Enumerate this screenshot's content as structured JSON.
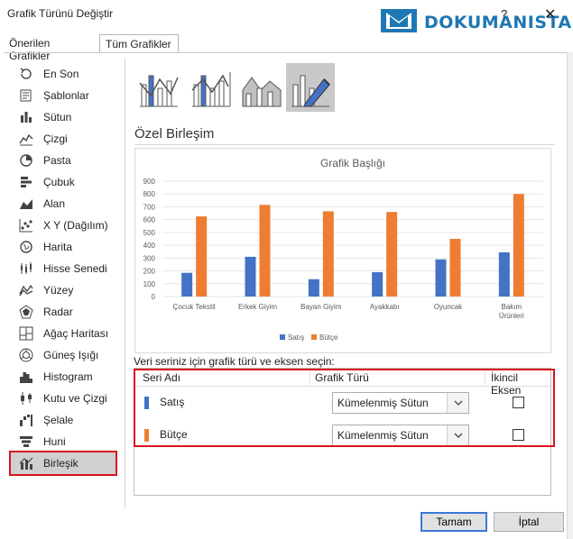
{
  "window": {
    "title": "Grafik Türünü Değiştir",
    "help": "?",
    "close": "✕"
  },
  "logo": {
    "text": "DOKUMANISTAN"
  },
  "tabs": [
    {
      "label": "Önerilen Grafikler"
    },
    {
      "label": "Tüm Grafikler"
    }
  ],
  "sidebar": {
    "items": [
      {
        "label": "En Son",
        "icon": "recent-icon"
      },
      {
        "label": "Şablonlar",
        "icon": "templates-icon"
      },
      {
        "label": "Sütun",
        "icon": "column-chart-icon"
      },
      {
        "label": "Çizgi",
        "icon": "line-chart-icon"
      },
      {
        "label": "Pasta",
        "icon": "pie-chart-icon"
      },
      {
        "label": "Çubuk",
        "icon": "bar-chart-icon"
      },
      {
        "label": "Alan",
        "icon": "area-chart-icon"
      },
      {
        "label": "X Y (Dağılım)",
        "icon": "scatter-chart-icon"
      },
      {
        "label": "Harita",
        "icon": "map-chart-icon"
      },
      {
        "label": "Hisse Senedi",
        "icon": "stock-chart-icon"
      },
      {
        "label": "Yüzey",
        "icon": "surface-chart-icon"
      },
      {
        "label": "Radar",
        "icon": "radar-chart-icon"
      },
      {
        "label": "Ağaç Haritası",
        "icon": "treemap-chart-icon"
      },
      {
        "label": "Güneş Işığı",
        "icon": "sunburst-chart-icon"
      },
      {
        "label": "Histogram",
        "icon": "histogram-chart-icon"
      },
      {
        "label": "Kutu ve Çizgi",
        "icon": "box-whisker-chart-icon"
      },
      {
        "label": "Şelale",
        "icon": "waterfall-chart-icon"
      },
      {
        "label": "Huni",
        "icon": "funnel-chart-icon"
      },
      {
        "label": "Birleşik",
        "icon": "combo-chart-icon",
        "selected": true
      }
    ]
  },
  "combo_types": [
    {
      "icon": "clustered-column-line-icon"
    },
    {
      "icon": "clustered-column-line-secondary-axis-icon"
    },
    {
      "icon": "stacked-area-clustered-column-icon"
    },
    {
      "icon": "custom-combination-icon",
      "selected": true
    }
  ],
  "section_heading": "Özel Birleşim",
  "chart_data": {
    "type": "bar",
    "title": "Grafik Başlığı",
    "categories": [
      "Çocuk Tekstil",
      "Erkek Giyim",
      "Bayan Giyim",
      "Ayakkabı",
      "Oyuncak",
      "Bakım Ürünleri"
    ],
    "series": [
      {
        "name": "Satış",
        "color": "#4472c4",
        "values": [
          185,
          310,
          135,
          190,
          290,
          345
        ]
      },
      {
        "name": "Bütçe",
        "color": "#ed7d31",
        "values": [
          625,
          715,
          665,
          660,
          450,
          800
        ]
      }
    ],
    "yticks": [
      "0",
      "100",
      "200",
      "300",
      "400",
      "500",
      "600",
      "700",
      "800",
      "900"
    ],
    "ylim": [
      0,
      900
    ],
    "grid": true,
    "legend": "bottom"
  },
  "series_prompt": "Veri seriniz için grafik türü ve eksen seçin:",
  "grid": {
    "headers": {
      "name": "Seri Adı",
      "type": "Grafik Türü",
      "secondary": "İkincil Eksen"
    },
    "rows": [
      {
        "name": "Satış",
        "color": "#4472c4",
        "chart_type": "Kümelenmiş Sütun",
        "secondary": false
      },
      {
        "name": "Bütçe",
        "color": "#ed7d31",
        "chart_type": "Kümelenmiş Sütun",
        "secondary": false
      }
    ]
  },
  "buttons": {
    "ok": "Tamam",
    "cancel": "İptal"
  }
}
